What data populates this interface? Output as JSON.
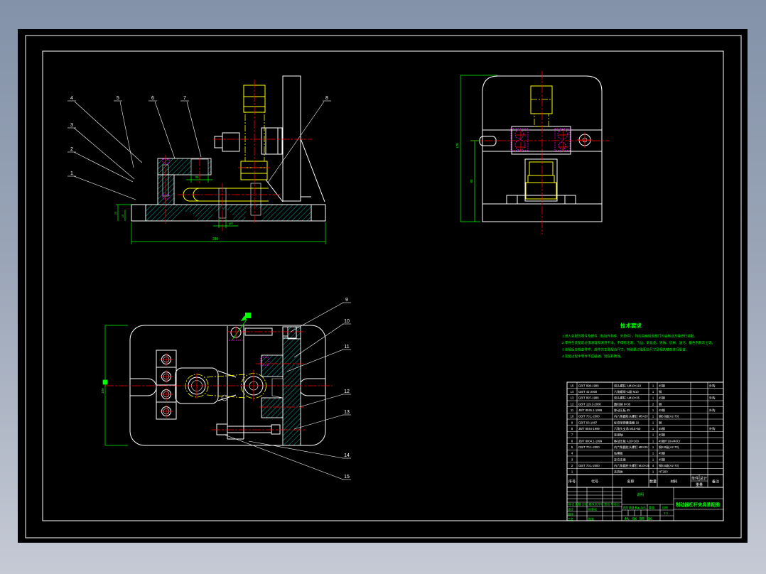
{
  "tech": {
    "title": "技术要求",
    "lines": [
      "1.进入装配的零件及部件（包括外购件、外协件），均应具有检验部门的合格证方能进行装配。",
      "2.零件在装配前必须清理和清洗干净，不得有毛刺、飞边、氧化皮、锈蚀、切屑、油污、着色剂和灰尘等。",
      "3.装配后应检查零件、部件的主要配合尺寸，特别是过盈配合尺寸及相关精度进行复查。",
      "4.装配过程中零件不应磕碰、划伤和锈蚀。"
    ]
  },
  "views": {
    "side": {
      "callouts": [
        "1",
        "2",
        "3",
        "4",
        "5",
        "6",
        "7",
        "8"
      ],
      "dims": {
        "overall": "280",
        "pin": "φ8",
        "slot": "35",
        "base_h": "25",
        "step_h": "15"
      }
    },
    "front": {
      "dims": {
        "height": "170",
        "mid": "90"
      }
    },
    "plan": {
      "callouts": [
        "9",
        "10",
        "11",
        "12",
        "13",
        "14",
        "15"
      ],
      "dims": {
        "width": "180"
      }
    }
  },
  "bom": {
    "headers": {
      "no": "序号",
      "code": "代号",
      "name": "名称",
      "qty": "数量",
      "material": "材料",
      "unit": "单件",
      "total": "总计",
      "weight": "重量",
      "remark": "备注"
    },
    "rows": [
      [
        "15",
        "GB/T 898-1988",
        "双头螺柱 AM10×110",
        "1",
        "45钢",
        "外购"
      ],
      [
        "14",
        "GB/T 41-2000",
        "六角螺母-C级 M10",
        "1",
        "钢",
        ""
      ],
      [
        "13",
        "GB/T 897-1988",
        "双头螺柱 AM10×35",
        "1",
        "45钢",
        "外购"
      ],
      [
        "12",
        "GB/T 119.2-2000",
        "圆柱销 6×30",
        "2",
        "钢",
        ""
      ],
      [
        "11",
        "JB/T 8045.1-1999",
        "移动压板 45",
        "1",
        "45钢",
        "外购"
      ],
      [
        "10",
        "GB/T 70.1-2000",
        "内六角圆柱头螺钉 M5×20",
        "1",
        "钢8.8级(A2-70)",
        ""
      ],
      [
        "9",
        "GB/T 93-1987",
        "标准型弹簧垫圈 10",
        "1",
        "钢",
        ""
      ],
      [
        "8",
        "JB/T 8044-1999",
        "六角头支承 M10×50",
        "1",
        "45钢",
        "外购"
      ],
      [
        "7",
        "",
        "连接轴",
        "1",
        "45钢",
        ""
      ],
      [
        "6",
        "JB/T 8004.1-1999",
        "移动压板 A10×100",
        "1",
        "45钢/T10A/40Cr",
        ""
      ],
      [
        "5",
        "GB/T 70.1-2000",
        "内六角圆柱头螺钉 M8×25",
        "1",
        "钢8.8级(A2-70)",
        ""
      ],
      [
        "4",
        "",
        "钻模板",
        "1",
        "45钢",
        ""
      ],
      [
        "3",
        "",
        "定位支座",
        "1",
        "45钢",
        ""
      ],
      [
        "2",
        "GB/T 70.1-2000",
        "内六角圆柱头螺钉 M10×35",
        "4",
        "钢8.8级(A2-70)",
        ""
      ],
      [
        "1",
        "",
        "夹具体",
        "1",
        "HT200",
        ""
      ]
    ]
  },
  "titleblock": {
    "revision_row": "标记 处数 分区 更改文件号 签名 年月日",
    "design": "设计",
    "check": "审核",
    "process": "工艺",
    "standard": "标准化",
    "approve": "批准",
    "stage": "阶段标记",
    "weight": "重量",
    "scale": "比例",
    "scale_value": "1:1",
    "sheets": "共 张 第 张",
    "note": "说明",
    "title": "制动器杠杆夹具装配图"
  },
  "colors": {
    "background_top": "#8392a9",
    "background_bottom": "#c5cad5",
    "paper": "#000000",
    "outline": "#ffffff",
    "section_hatch": "#00dcdc",
    "workpiece": "#ffff00",
    "centerline": "#ff0000",
    "dimension": "#00ff00",
    "hidden_detail": "#ff00ff"
  }
}
